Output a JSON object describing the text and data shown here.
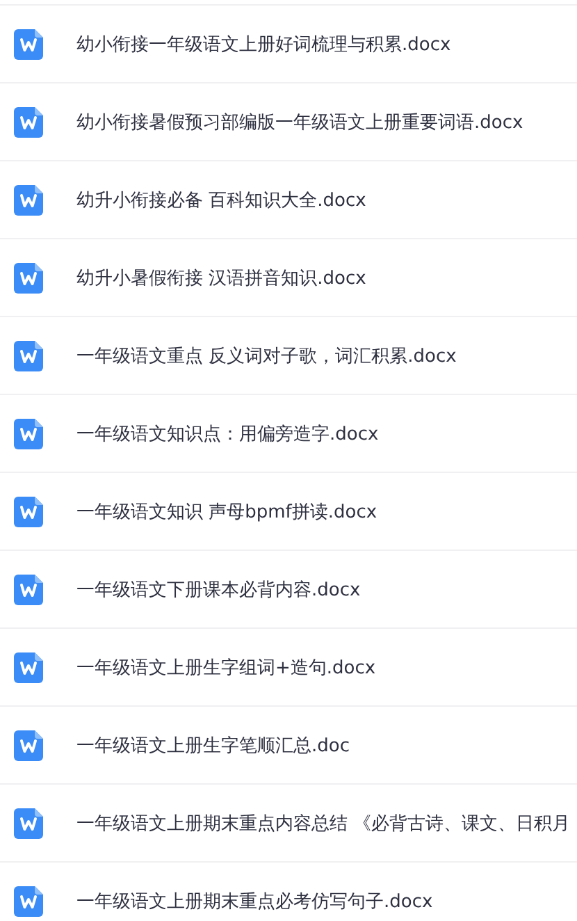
{
  "files": [
    {
      "name": "幼小衔接一年级语文上册好词梳理与积累.docx"
    },
    {
      "name": "幼小衔接暑假预习部编版一年级语文上册重要词语.docx"
    },
    {
      "name": "幼升小衔接必备 百科知识大全.docx"
    },
    {
      "name": "幼升小暑假衔接 汉语拼音知识.docx"
    },
    {
      "name": "一年级语文重点 反义词对子歌，词汇积累.docx"
    },
    {
      "name": "一年级语文知识点：用偏旁造字.docx"
    },
    {
      "name": "一年级语文知识 声母bpmf拼读.docx"
    },
    {
      "name": "一年级语文下册课本必背内容.docx"
    },
    {
      "name": "一年级语文上册生字组词+造句.docx"
    },
    {
      "name": "一年级语文上册生字笔顺汇总.doc"
    },
    {
      "name": "一年级语文上册期末重点内容总结 《必背古诗、课文、日积月"
    },
    {
      "name": "一年级语文上册期末重点必考仿写句子.docx"
    }
  ]
}
